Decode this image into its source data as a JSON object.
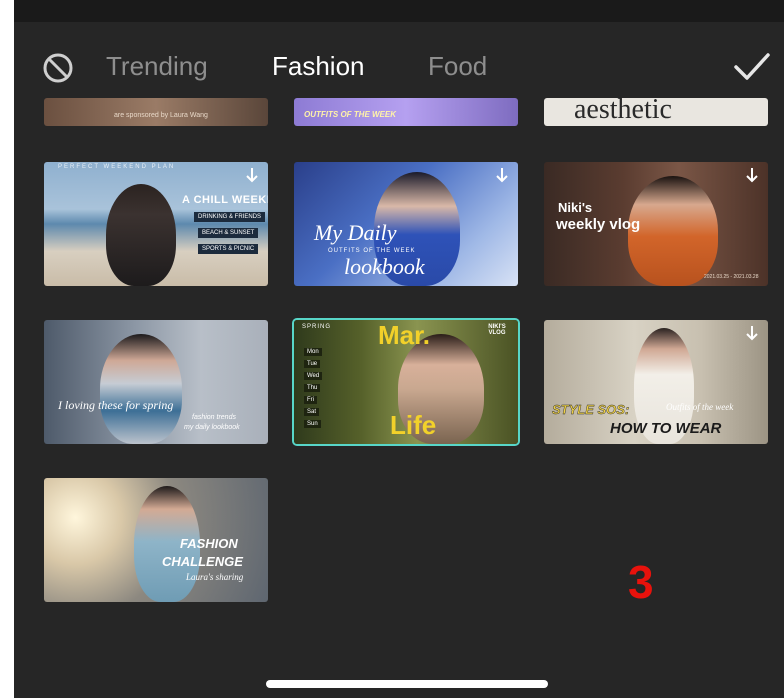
{
  "tabs": {
    "none_icon": "prohibit-icon",
    "items": [
      {
        "label": "Trending",
        "active": false
      },
      {
        "label": "Fashion",
        "active": true
      },
      {
        "label": "Food",
        "active": false
      }
    ],
    "confirm_icon": "checkmark-icon"
  },
  "partial_row": {
    "t1": "are sponsored by Laura Wang",
    "t2": "OUTFITS OF THE WEEK",
    "t3": "aesthetic"
  },
  "templates": [
    {
      "l1": "A CHILL WEEKEND",
      "l2": "DRINKING & FRIENDS",
      "l3": "BEACH & SUNSET",
      "l4": "SPORTS & PICNIC",
      "top": "PERFECT WEEKEND PLAN"
    },
    {
      "l1": "My Daily",
      "l2": "OUTFITS OF THE WEEK",
      "l3": "lookbook"
    },
    {
      "l1": "Niki's",
      "l2": "weekly vlog",
      "date": "2021.03.25 - 2021.03.28"
    },
    {
      "l1": "I loving these for spring",
      "l2": "fashion trends",
      "l3": "my daily lookbook"
    },
    {
      "l1": "Mar.",
      "l2": "Life",
      "spring": "SPRING",
      "tag": "NIKI'S VLOG",
      "days": [
        "Mon",
        "Tue",
        "Wed",
        "Thu",
        "Fri",
        "Sat",
        "Sun"
      ]
    },
    {
      "l1": "STYLE SOS:",
      "l2": "HOW TO WEAR",
      "l3": "Outfits of the week"
    },
    {
      "l1": "FASHION",
      "l2": "CHALLENGE",
      "l3": "Laura's sharing"
    }
  ],
  "page_number": "3",
  "colors": {
    "panel": "#262626",
    "selected_border": "#58d6c8",
    "page_number": "#e8120c"
  }
}
